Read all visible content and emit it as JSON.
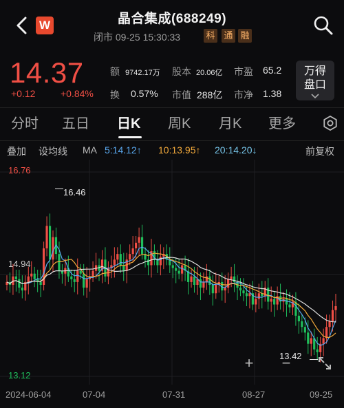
{
  "header": {
    "title": "晶合集成(688249)",
    "subtitle": "闭市 09-25 15:30:33",
    "logo_text": "W",
    "tags": [
      "科",
      "通",
      "融"
    ],
    "back_icon": "chevron-left-icon",
    "search_icon": "search-icon"
  },
  "quote": {
    "price": "14.37",
    "change": "+0.12",
    "change_pct": "+0.84%",
    "stats": [
      {
        "label": "额",
        "value": "9742.17万"
      },
      {
        "label": "股本",
        "value": "20.06亿"
      },
      {
        "label": "市盈",
        "value": "65.2"
      },
      {
        "label": "换",
        "value": "0.57%"
      },
      {
        "label": "市值",
        "value": "288亿"
      },
      {
        "label": "市净",
        "value": "1.38"
      }
    ],
    "wande_line1": "万得",
    "wande_line2": "盘口",
    "up_color": "#f04f45",
    "down_color": "#1fbf5c"
  },
  "tabs": [
    "分时",
    "五日",
    "日K",
    "周K",
    "月K",
    "更多"
  ],
  "active_tab": "日K",
  "ma_row": {
    "overlay": "叠加",
    "tool": "设均线",
    "ma_label": "MA",
    "ma5": "5:14.12↑",
    "ma10": "10:13.95↑",
    "ma20": "20:14.20↓",
    "adjust": "前复权",
    "ma5_color": "#5aa9f0",
    "ma10_color": "#f2a93b",
    "ma20_color": "#76c4e8"
  },
  "chart_data": {
    "type": "candlestick",
    "ylim": [
      13.12,
      16.76
    ],
    "y_top_label": "16.76",
    "y_mid_label": "14.94",
    "y_bottom_label": "13.12",
    "high_marker": "16.46",
    "low_marker": "13.42",
    "x_labels": [
      "2024-06-04",
      "07-04",
      "07-31",
      "08-27",
      "09-25"
    ],
    "closes": [
      14.8,
      14.75,
      14.9,
      14.85,
      14.7,
      14.65,
      14.8,
      14.9,
      14.95,
      14.85,
      14.8,
      14.75,
      15.4,
      15.8,
      15.2,
      15.6,
      15.3,
      15.0,
      14.95,
      15.05,
      14.9,
      14.85,
      14.8,
      15.0,
      14.95,
      14.7,
      14.85,
      14.9,
      15.0,
      15.1,
      15.0,
      15.2,
      14.9,
      15.05,
      15.1,
      15.2,
      15.3,
      15.1,
      15.0,
      15.2,
      15.3,
      15.4,
      15.5,
      15.6,
      15.3,
      15.2,
      15.1,
      15.35,
      15.2,
      15.1,
      15.25,
      15.3,
      15.2,
      15.1,
      15.05,
      15.0,
      14.95,
      15.1,
      15.0,
      14.8,
      14.9,
      14.75,
      14.85,
      14.7,
      14.8,
      14.9,
      14.75,
      14.6,
      14.75,
      14.8,
      14.65,
      14.7,
      14.85,
      14.9,
      14.8,
      14.7,
      14.65,
      14.6,
      14.55,
      14.6,
      14.4,
      14.5,
      14.6,
      14.55,
      14.7,
      14.45,
      14.5,
      14.4,
      14.55,
      14.45,
      14.5,
      14.4,
      14.35,
      14.45,
      14.2,
      14.1,
      14.0,
      13.9,
      13.7,
      13.8,
      13.6,
      13.55,
      13.7,
      13.8,
      14.0,
      14.1,
      14.3,
      14.37
    ]
  },
  "controls": {
    "zoom_in": "+",
    "zoom_out": "−",
    "expand_icon": "expand-icon"
  }
}
